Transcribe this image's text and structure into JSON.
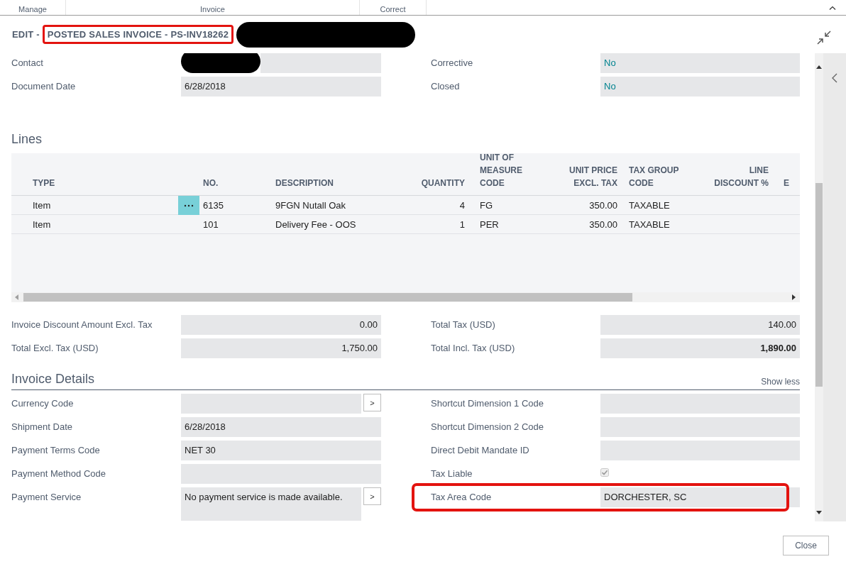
{
  "ribbon": {
    "tabs": [
      {
        "label": "Manage",
        "selected": false
      },
      {
        "label": "Invoice",
        "selected": false
      },
      {
        "label": "Correct",
        "selected": false
      }
    ]
  },
  "title": {
    "prefix": "EDIT -",
    "highlighted": "POSTED SALES INVOICE - PS-INV18262",
    "redacted": true
  },
  "general": {
    "left": [
      {
        "label": "Contact",
        "redacted": true
      },
      {
        "label": "Document Date",
        "value": "6/28/2018"
      }
    ],
    "right": [
      {
        "label": "Corrective",
        "value": "No",
        "kind": "link"
      },
      {
        "label": "Closed",
        "value": "No",
        "kind": "link"
      }
    ]
  },
  "lines": {
    "heading": "Lines",
    "columns": [
      {
        "label": "TYPE"
      },
      {},
      {
        "label": "NO."
      },
      {
        "label": "DESCRIPTION"
      },
      {
        "label": "QUANTITY"
      },
      {
        "label": "UNIT OF MEASURE CODE"
      },
      {
        "label": "UNIT PRICE EXCL. TAX"
      },
      {
        "label": "TAX GROUP CODE"
      },
      {
        "label": "LINE DISCOUNT %"
      },
      {
        "label": "E"
      }
    ],
    "rows": [
      {
        "selected": true,
        "cells": [
          "Item",
          "",
          "6135",
          "9FGN Nutall Oak",
          "4",
          "FG",
          "350.00",
          "TAXABLE",
          "",
          ""
        ]
      },
      {
        "selected": false,
        "cells": [
          "Item",
          "",
          "101",
          "Delivery Fee - OOS",
          "1",
          "PER",
          "350.00",
          "TAXABLE",
          "",
          ""
        ]
      }
    ]
  },
  "totals": {
    "left": [
      {
        "label": "Invoice Discount Amount Excl. Tax",
        "value": "0.00"
      },
      {
        "label": "Total Excl. Tax (USD)",
        "value": "1,750.00"
      }
    ],
    "right": [
      {
        "label": "Total Tax (USD)",
        "value": "140.00"
      },
      {
        "label": "Total Incl. Tax (USD)",
        "value": "1,890.00",
        "bold": true
      }
    ]
  },
  "invoice_details": {
    "heading": "Invoice Details",
    "toggle": "Show less",
    "left": [
      {
        "label": "Currency Code",
        "lookup": ">"
      },
      {
        "label": "Shipment Date",
        "value": "6/28/2018"
      },
      {
        "label": "Payment Terms Code",
        "value": "NET 30"
      },
      {
        "label": "Payment Method Code"
      },
      {
        "label": "Payment Service",
        "value": "No payment service is made available.",
        "lookup": ">",
        "kind": "multiline"
      }
    ],
    "right": [
      {
        "label": "Shortcut Dimension 1 Code"
      },
      {
        "label": "Shortcut Dimension 2 Code"
      },
      {
        "label": "Direct Debit Mandate ID"
      },
      {
        "label": "Tax Liable",
        "kind": "checkbox",
        "checked": true
      },
      {
        "label": "Tax Area Code",
        "value": "DORCHESTER, SC",
        "highlighted": true
      }
    ]
  },
  "footer": {
    "buttons": [
      "Close"
    ]
  }
}
